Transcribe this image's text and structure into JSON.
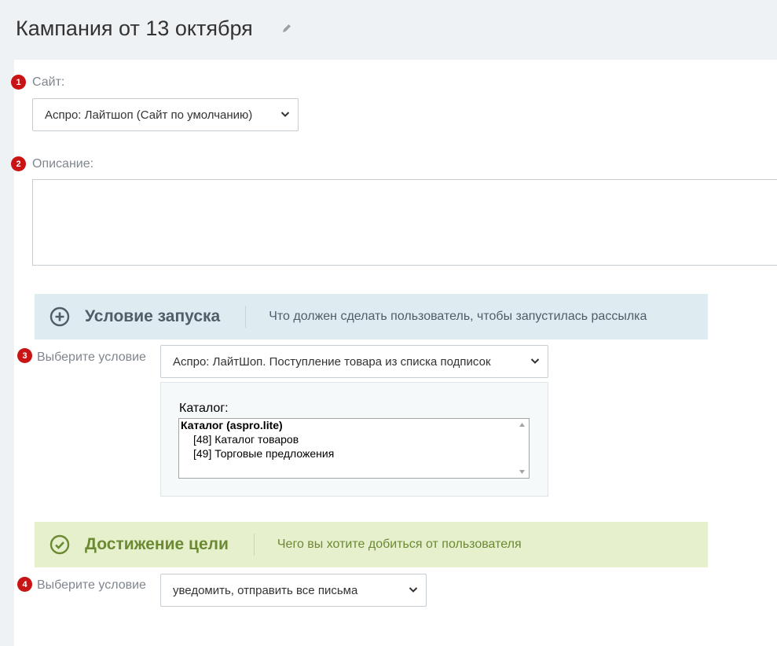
{
  "header": {
    "title": "Кампания от 13 октября"
  },
  "form": {
    "site": {
      "badge": "1",
      "label": "Сайт:",
      "value": "Аспро: Лайтшоп (Сайт по умолчанию)"
    },
    "description": {
      "badge": "2",
      "label": "Описание:",
      "value": ""
    }
  },
  "trigger": {
    "title": "Условие запуска",
    "description": "Что должен сделать пользователь, чтобы запустилась рассылка",
    "badge": "3",
    "condition_label": "Выберите условие",
    "condition_value": "Аспро: ЛайтШоп. Поступление товара из списка подписок",
    "catalog_label": "Каталог:",
    "catalog_options": [
      "Каталог (aspro.lite)",
      "[48] Каталог товаров",
      "[49] Торговые предложения"
    ]
  },
  "goal": {
    "title": "Достижение цели",
    "description": "Чего вы хотите добиться от пользователя",
    "badge": "4",
    "condition_label": "Выберите условие",
    "condition_value": "уведомить, отправить все письма"
  },
  "colors": {
    "badge": "#c81414",
    "trigger_bar": "#deecf1",
    "trigger_text": "#525c69",
    "goal_bar": "#e6f0cd",
    "goal_text": "#6b8a32"
  }
}
